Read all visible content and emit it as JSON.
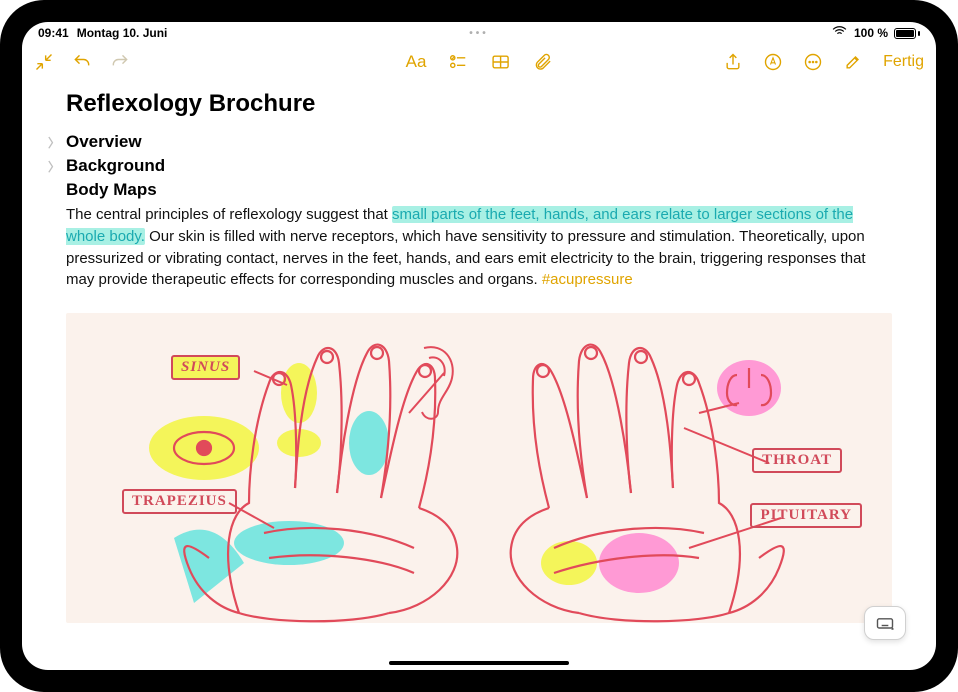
{
  "status": {
    "time": "09:41",
    "date": "Montag 10. Juni",
    "battery": "100 %"
  },
  "toolbar": {
    "done": "Fertig"
  },
  "note": {
    "title": "Reflexology Brochure",
    "sections": [
      {
        "label": "Overview",
        "collapsed": true
      },
      {
        "label": "Background",
        "collapsed": true
      },
      {
        "label": "Body Maps",
        "collapsed": false
      }
    ],
    "body_pre": "The central principles of reflexology suggest that ",
    "body_highlight": "small parts of the feet, hands, and ears relate to larger sections of the whole body.",
    "body_post": " Our skin is filled with nerve receptors, which have sensitivity to pressure and stimulation. Theoretically, upon pressurized or vibrating contact, nerves in the feet, hands, and ears emit electricity to the brain, triggering responses that may provide therapeutic effects for corresponding muscles and organs. ",
    "hashtag": "#acupressure"
  },
  "sketch": {
    "labels": {
      "sinus": "SINUS",
      "trapezius": "TRAPEZIUS",
      "throat": "THROAT",
      "pituitary": "PITUITARY"
    }
  }
}
